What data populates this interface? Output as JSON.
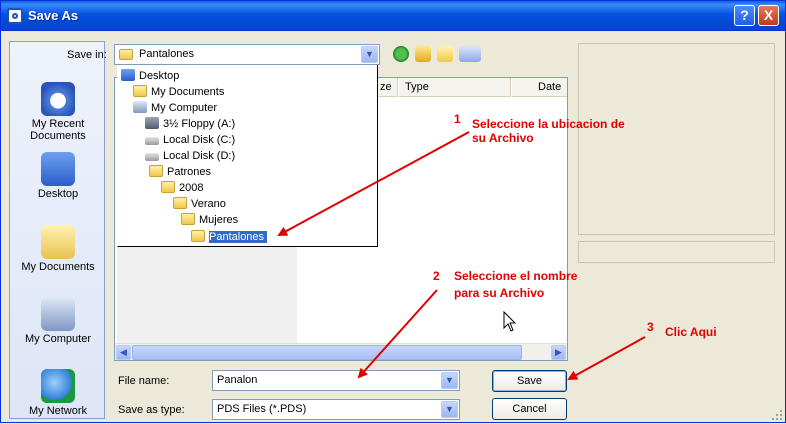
{
  "window": {
    "title": "Save As",
    "help_label": "?",
    "close_label": "X"
  },
  "places": [
    {
      "label": "My Recent Documents",
      "icon": "recent-documents-icon"
    },
    {
      "label": "Desktop",
      "icon": "desktop-icon"
    },
    {
      "label": "My Documents",
      "icon": "my-documents-icon"
    },
    {
      "label": "My Computer",
      "icon": "my-computer-icon"
    },
    {
      "label": "My Network",
      "icon": "my-network-icon"
    }
  ],
  "save_in": {
    "label": "Save in:",
    "value": "Pantalones"
  },
  "columns": {
    "size_partial": "ze",
    "type": "Type",
    "date": "Date Mo"
  },
  "tree": [
    {
      "label": "Desktop",
      "icon": "desktop-icon"
    },
    {
      "label": "My Documents",
      "icon": "my-documents-icon"
    },
    {
      "label": "My Computer",
      "icon": "my-computer-icon"
    },
    {
      "label": "3½ Floppy (A:)",
      "icon": "floppy-icon"
    },
    {
      "label": "Local Disk (C:)",
      "icon": "disk-icon"
    },
    {
      "label": "Local Disk (D:)",
      "icon": "disk-icon"
    },
    {
      "label": "Patrones",
      "icon": "folder-icon"
    },
    {
      "label": "2008",
      "icon": "folder-icon"
    },
    {
      "label": "Verano",
      "icon": "folder-icon"
    },
    {
      "label": "Mujeres",
      "icon": "folder-icon"
    },
    {
      "label": "Pantalones",
      "icon": "folder-icon",
      "selected": true
    }
  ],
  "file_name": {
    "label": "File name:",
    "value": "Panalon"
  },
  "save_as_type": {
    "label": "Save as type:",
    "value": "PDS Files (*.PDS)"
  },
  "buttons": {
    "save": "Save",
    "cancel": "Cancel"
  },
  "annotations": {
    "step1_num": "1",
    "step1_line1": "Seleccione la ubicacion de",
    "step1_line2": "su Archivo",
    "step2_num": "2",
    "step2_line1": "Seleccione el nombre",
    "step2_line2": "para su Archivo",
    "step3_num": "3",
    "step3_text": "Clic Aqui",
    "color": "#e00000"
  }
}
